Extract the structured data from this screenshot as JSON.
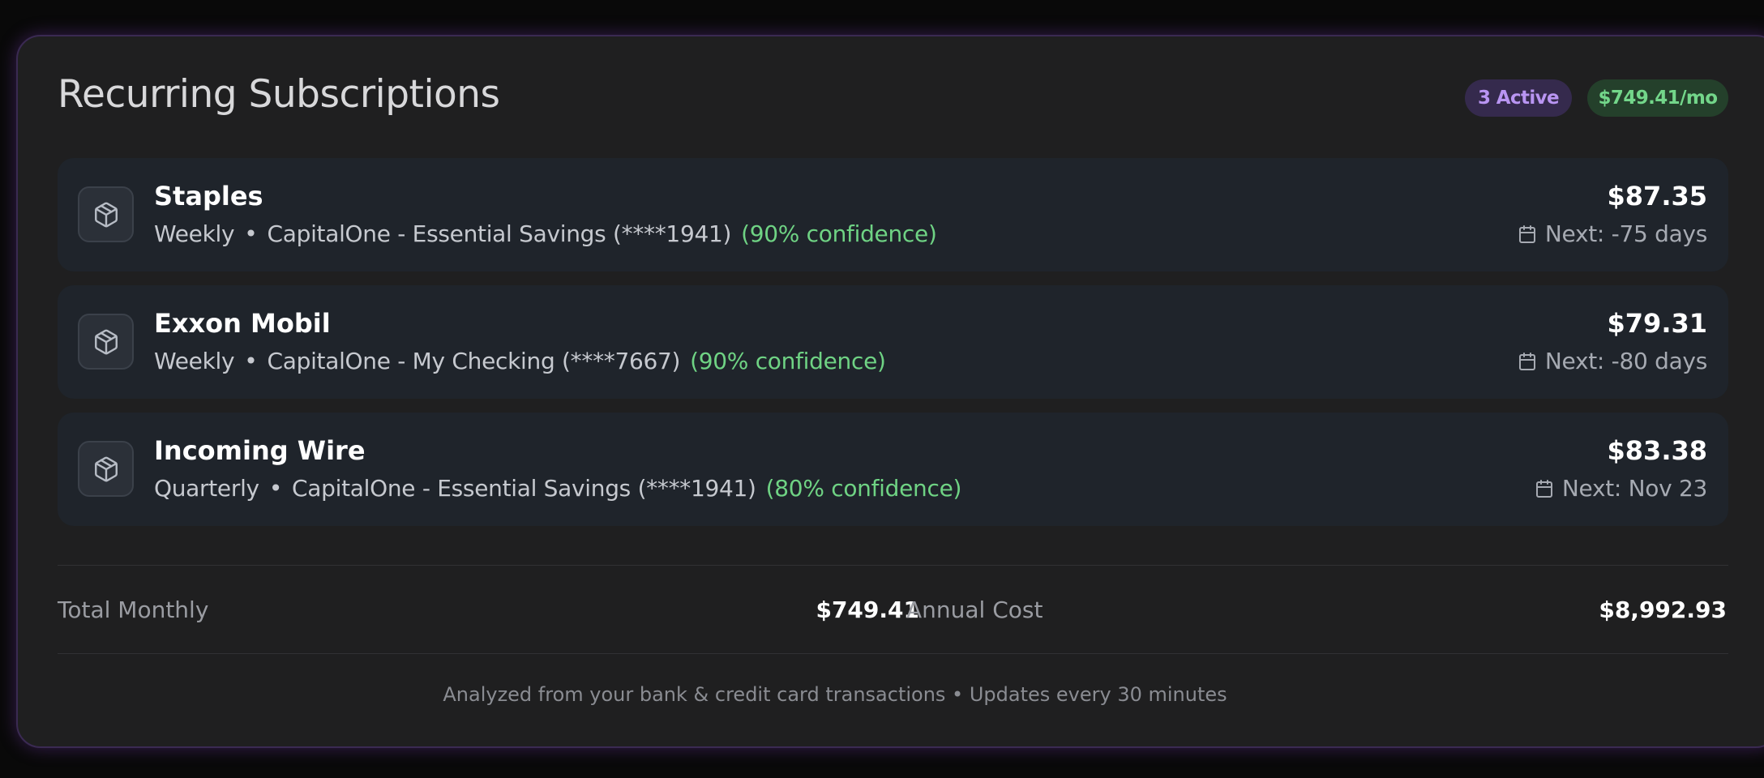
{
  "card": {
    "title": "Recurring Subscriptions",
    "badges": {
      "active": "3 Active",
      "monthly": "$749.41/mo"
    }
  },
  "subscriptions": [
    {
      "name": "Staples",
      "frequency": "Weekly",
      "separator": "•",
      "account": "CapitalOne - Essential Savings (****1941)",
      "confidence": "(90% confidence)",
      "amount": "$87.35",
      "next": "Next: -75 days",
      "icon": "package-icon"
    },
    {
      "name": "Exxon Mobil",
      "frequency": "Weekly",
      "separator": "•",
      "account": "CapitalOne - My Checking (****7667)",
      "confidence": "(90% confidence)",
      "amount": "$79.31",
      "next": "Next: -80 days",
      "icon": "package-icon"
    },
    {
      "name": "Incoming Wire",
      "frequency": "Quarterly",
      "separator": "•",
      "account": "CapitalOne - Essential Savings (****1941)",
      "confidence": "(80% confidence)",
      "amount": "$83.38",
      "next": "Next: Nov 23",
      "icon": "package-icon"
    }
  ],
  "summary": {
    "total_label": "Total Monthly",
    "total_value": "$749.41",
    "annual_label": "Annual Cost",
    "annual_value": "$8,992.93"
  },
  "footer": {
    "text": "Analyzed from your bank & credit card transactions • Updates every 30 minutes"
  },
  "colors": {
    "accent_purple": "#b995f2",
    "accent_green": "#73d68a",
    "confidence_green": "#6fd384",
    "card_bg": "#1f1f20",
    "row_bg": "#1f242b"
  }
}
